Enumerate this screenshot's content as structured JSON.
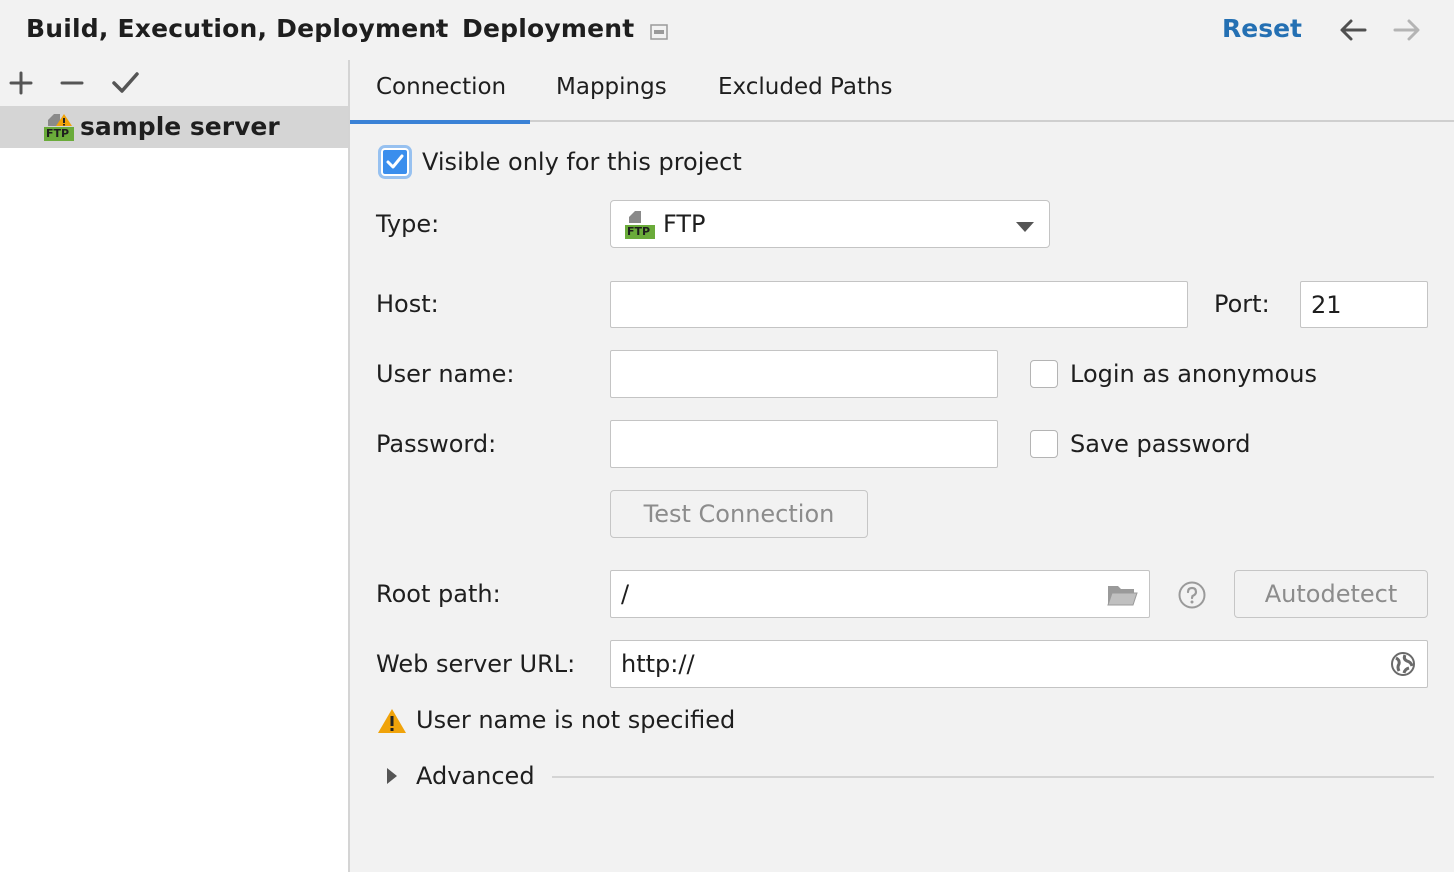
{
  "header": {
    "breadcrumb_parent": "Build, Execution, Deployment",
    "breadcrumb_separator": "›",
    "breadcrumb_current": "Deployment",
    "reset_label": "Reset"
  },
  "sidebar": {
    "tree_items": [
      {
        "label": "sample server",
        "icon_badge": "FTP",
        "icon": "ftp-server-warning-icon"
      }
    ]
  },
  "tabs": [
    {
      "label": "Connection",
      "active": true
    },
    {
      "label": "Mappings",
      "active": false
    },
    {
      "label": "Excluded Paths",
      "active": false
    }
  ],
  "connection": {
    "visible_only_label": "Visible only for this project",
    "visible_only_checked": true,
    "type_label": "Type:",
    "type_value": "FTP",
    "type_icon_badge": "FTP",
    "host_label": "Host:",
    "host_value": "",
    "port_label": "Port:",
    "port_value": "21",
    "username_label": "User name:",
    "username_value": "",
    "login_anonymous_label": "Login as anonymous",
    "login_anonymous_checked": false,
    "password_label": "Password:",
    "password_value": "",
    "save_password_label": "Save password",
    "save_password_checked": false,
    "test_connection_label": "Test Connection",
    "root_path_label": "Root path:",
    "root_path_value": "/",
    "autodetect_label": "Autodetect",
    "web_url_label": "Web server URL:",
    "web_url_value": "http://",
    "warning_text": "User name is not specified",
    "advanced_label": "Advanced"
  },
  "colors": {
    "accent": "#3b82d6",
    "link": "#2470b3",
    "warning": "#f0a30a",
    "ftp_badge": "#6aab3a"
  }
}
